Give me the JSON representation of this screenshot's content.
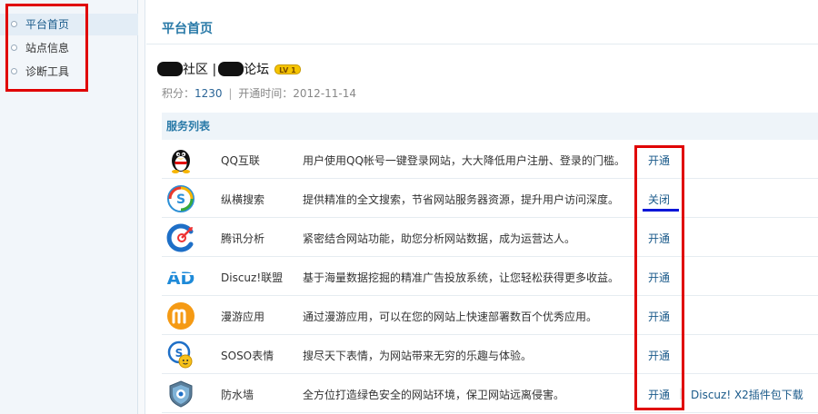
{
  "sidebar": {
    "items": [
      {
        "label": "平台首页",
        "active": true
      },
      {
        "label": "站点信息",
        "active": false
      },
      {
        "label": "诊断工具",
        "active": false
      }
    ]
  },
  "main": {
    "title": "平台首页",
    "site": {
      "name_part1": "社区 |",
      "name_part2": "论坛",
      "level_badge": "LV 1"
    },
    "meta": {
      "points_label": "积分：",
      "points_value": "1230",
      "separator": "|",
      "open_time_label": "开通时间：",
      "open_time_value": "2012-11-14"
    },
    "services": {
      "header": "服务列表",
      "items": [
        {
          "icon": "qq-penguin-icon",
          "name": "QQ互联",
          "desc": "用户使用QQ帐号一键登录网站，大大降低用户注册、登录的门槛。",
          "action": "开通"
        },
        {
          "icon": "soso-search-icon",
          "name": "纵横搜索",
          "desc": "提供精准的全文搜索，节省网站服务器资源，提升用户访问深度。",
          "action": "关闭"
        },
        {
          "icon": "tencent-analytics-icon",
          "name": "腾讯分析",
          "desc": "紧密结合网站功能，助您分析网站数据，成为运营达人。",
          "action": "开通"
        },
        {
          "icon": "discuz-ad-icon",
          "name": "Discuz!联盟",
          "desc": "基于海量数据挖掘的精准广告投放系统，让您轻松获得更多收益。",
          "action": "开通"
        },
        {
          "icon": "manyou-app-icon",
          "name": "漫游应用",
          "desc": "通过漫游应用，可以在您的网站上快速部署数百个优秀应用。",
          "action": "开通"
        },
        {
          "icon": "soso-emoji-icon",
          "name": "SOSO表情",
          "desc": "搜尽天下表情，为网站带来无穷的乐趣与体验。",
          "action": "开通"
        },
        {
          "icon": "firewall-shield-icon",
          "name": "防水墙",
          "desc": "全方位打造绿色安全的网站环境，保卫网站远离侵害。",
          "action": "开通",
          "extra": "Discuz! X2插件包下载"
        }
      ]
    }
  },
  "colors": {
    "accent": "#2a7aa8",
    "link": "#1a5a8a",
    "highlight_box": "#e00000",
    "underline_mark": "#0a16d8"
  }
}
